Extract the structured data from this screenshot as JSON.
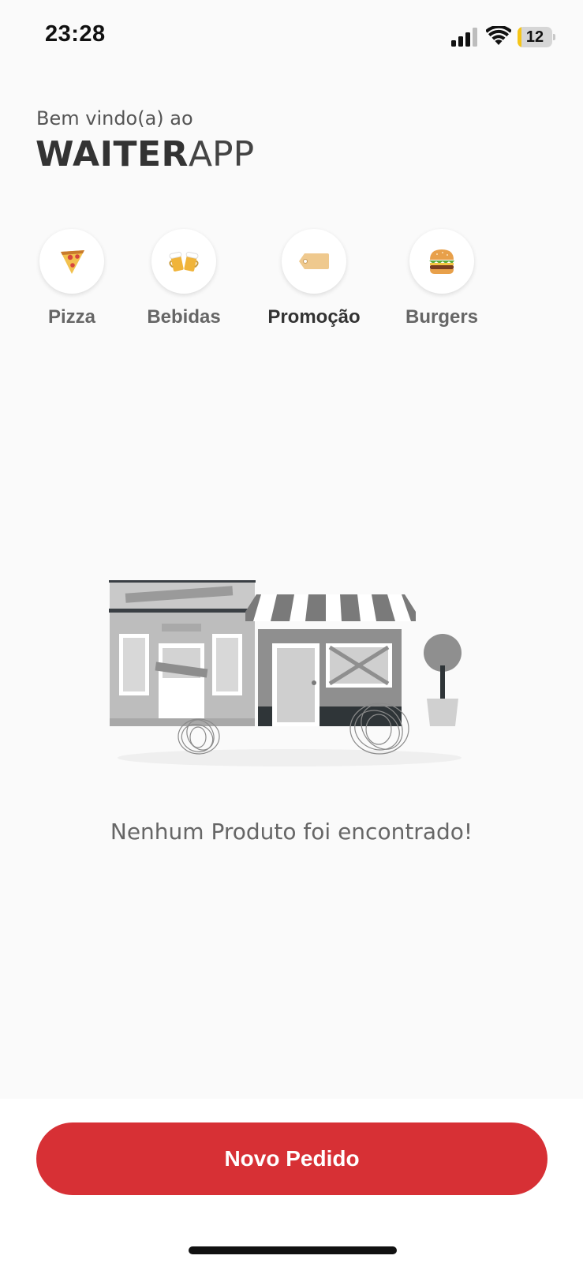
{
  "status_bar": {
    "time": "23:28",
    "battery_level": "12",
    "battery_fraction": 0.12,
    "signal_icon": "signal-icon",
    "wifi_icon": "wifi-icon",
    "battery_icon": "battery-icon"
  },
  "header": {
    "welcome": "Bem vindo(a) ao",
    "brand_bold": "WAITER",
    "brand_light": "APP"
  },
  "categories": [
    {
      "label": "Pizza",
      "icon": "pizza-icon",
      "active": false
    },
    {
      "label": "Bebidas",
      "icon": "beer-mugs-icon",
      "active": false
    },
    {
      "label": "Promoção",
      "icon": "price-tag-icon",
      "active": true
    },
    {
      "label": "Burgers",
      "icon": "burger-icon",
      "active": false
    }
  ],
  "empty_state": {
    "illustration": "closed-shops-illustration",
    "message": "Nenhum Produto foi encontrado!"
  },
  "footer": {
    "button_label": "Novo Pedido"
  },
  "colors": {
    "accent": "#d73035",
    "background": "#fafafa",
    "text_dark": "#333333",
    "text_muted": "#666666",
    "battery_fill": "#f5c518"
  }
}
